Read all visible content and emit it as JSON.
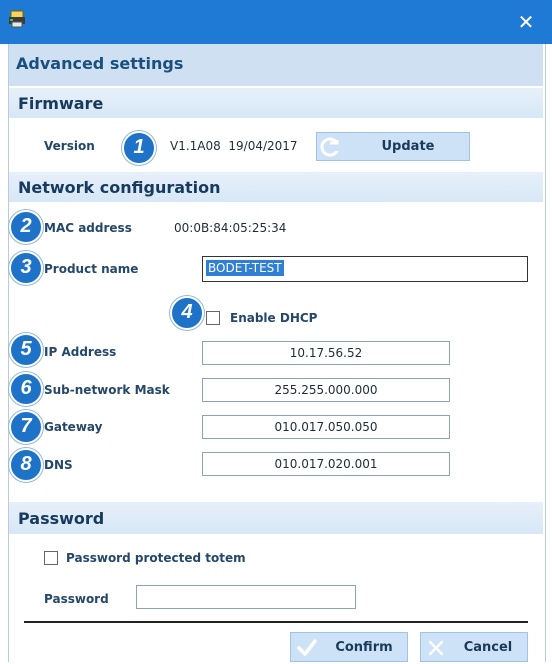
{
  "window": {
    "close_glyph": "✕",
    "app_icon": "printer-icon"
  },
  "title": "Advanced settings",
  "firmware": {
    "heading": "Firmware",
    "version_label": "Version",
    "version_value": "V1.1A08  19/04/2017",
    "update_label": "Update"
  },
  "network": {
    "heading": "Network configuration",
    "mac_label": "MAC address",
    "mac_value": "00:0B:84:05:25:34",
    "product_label": "Product name",
    "product_value": "BODET-TEST",
    "dhcp_label": "Enable DHCP",
    "dhcp_checked": false,
    "ip_label": "IP Address",
    "ip_value": "10.17.56.52",
    "mask_label": "Sub-network Mask",
    "mask_value": "255.255.000.000",
    "gateway_label": "Gateway",
    "gateway_value": "010.017.050.050",
    "dns_label": "DNS",
    "dns_value": "010.017.020.001"
  },
  "password": {
    "heading": "Password",
    "protected_label": "Password protected totem",
    "protected_checked": false,
    "password_label": "Password",
    "password_value": ""
  },
  "badges": [
    "1",
    "2",
    "3",
    "4",
    "5",
    "6",
    "7",
    "8"
  ],
  "actions": {
    "confirm_label": "Confirm",
    "cancel_label": "Cancel"
  },
  "colors": {
    "titlebar": "#1f7ad6",
    "accent": "#1e73c9",
    "button": "#cde2f7"
  }
}
